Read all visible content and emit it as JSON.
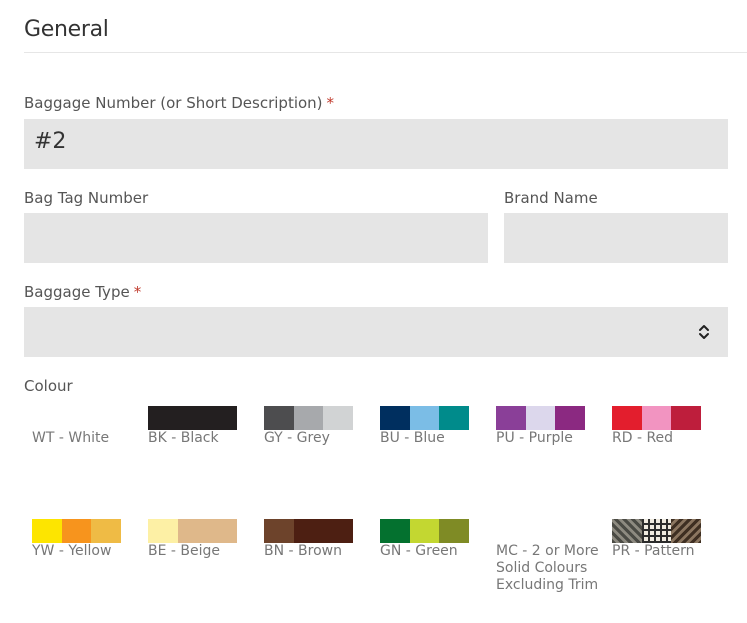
{
  "section": {
    "title": "General"
  },
  "baggage_number": {
    "label": "Baggage Number (or Short Description)",
    "required_mark": "*",
    "value": "#2"
  },
  "bag_tag": {
    "label": "Bag Tag Number",
    "value": ""
  },
  "brand": {
    "label": "Brand Name",
    "value": ""
  },
  "baggage_type": {
    "label": "Baggage Type",
    "required_mark": "*",
    "selected": ""
  },
  "colour": {
    "label": "Colour",
    "options": [
      {
        "code": "WT",
        "label": "WT - White",
        "colors": [
          "#ffffff",
          "#ffffff",
          "#ffffff"
        ]
      },
      {
        "code": "BK",
        "label": "BK - Black",
        "colors": [
          "#231f20",
          "#231f20",
          "#231f20"
        ]
      },
      {
        "code": "GY",
        "label": "GY - Grey",
        "colors": [
          "#4d4d4f",
          "#a7a9ac",
          "#d1d3d4"
        ]
      },
      {
        "code": "BU",
        "label": "BU - Blue",
        "colors": [
          "#002f5f",
          "#7bbde6",
          "#008b8b"
        ]
      },
      {
        "code": "PU",
        "label": "PU - Purple",
        "colors": [
          "#8a3f98",
          "#dcd7ec",
          "#8b2981"
        ]
      },
      {
        "code": "RD",
        "label": "RD - Red",
        "colors": [
          "#e31e2d",
          "#f294c1",
          "#be1e3c"
        ]
      },
      {
        "code": "YW",
        "label": "YW - Yellow",
        "colors": [
          "#fde500",
          "#f7941d",
          "#efbb45"
        ]
      },
      {
        "code": "BE",
        "label": "BE - Beige",
        "colors": [
          "#fdf0a5",
          "#dfb88a",
          "#dfb88a"
        ]
      },
      {
        "code": "BN",
        "label": "BN - Brown",
        "colors": [
          "#6d432b",
          "#4d1f12",
          "#4d1f12"
        ]
      },
      {
        "code": "GN",
        "label": "GN - Green",
        "colors": [
          "#04712f",
          "#c3d731",
          "#7f8b25"
        ]
      },
      {
        "code": "MC",
        "label": "MC - 2 or More Solid Colours Excluding Trim",
        "colors": [
          "#ffffff",
          "#ffffff",
          "#ffffff"
        ]
      },
      {
        "code": "PR",
        "label": "PR - Pattern",
        "colors": [
          "#5a5a55",
          "#e8e2d6",
          "#6b5b4b"
        ]
      }
    ]
  }
}
